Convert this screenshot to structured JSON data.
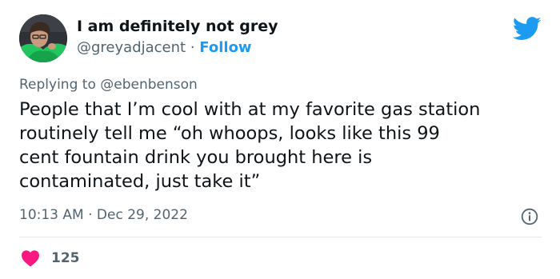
{
  "author": {
    "display_name": "I am definitely not grey",
    "handle": "@greyadjacent",
    "separator": "·",
    "follow_label": "Follow"
  },
  "reply": {
    "prefix": "Replying to",
    "handle": "@ebenbenson"
  },
  "tweet": {
    "text_lines": [
      "People that I’m cool with at my favorite gas station",
      "routinely tell me “oh whoops, looks like this 99",
      "cent fountain drink you brought here is",
      "contaminated, just take it”"
    ],
    "time": "10:13 AM",
    "separator": "·",
    "date": "Dec 29, 2022"
  },
  "engagement": {
    "likes": "125"
  },
  "icons": {
    "logo": "twitter-bird-icon",
    "info": "info-icon",
    "like": "heart-icon"
  },
  "colors": {
    "brand_blue": "#1d9bf0",
    "text_primary": "#0f1419",
    "text_secondary": "#536471",
    "like_pink": "#f91880",
    "divider": "#e7e9ea",
    "avatar_shirt": "#22c55e"
  }
}
